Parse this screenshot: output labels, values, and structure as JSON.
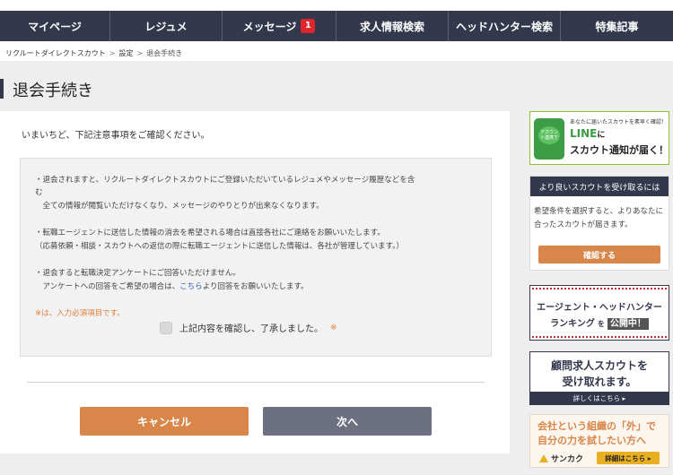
{
  "nav": {
    "items": [
      {
        "label": "マイページ"
      },
      {
        "label": "レジュメ"
      },
      {
        "label": "メッセージ",
        "badge": "1"
      },
      {
        "label": "求人情報検索"
      },
      {
        "label": "ヘッドハンター検索"
      },
      {
        "label": "特集記事"
      }
    ]
  },
  "breadcrumb": {
    "items": [
      "リクルートダイレクトスカウト",
      "設定",
      "退会手続き"
    ],
    "separator": ">"
  },
  "page": {
    "title": "退会手続き",
    "intro": "いまいちど、下記注意事項をご確認ください。"
  },
  "notice": {
    "line1a": "・退会されますと、リクルートダイレクトスカウトにご登録いただいているレジュメやメッセージ履歴などを含",
    "line1b": "む",
    "line1c": "　全ての情報が閲覧いただけなくなり、メッセージのやりとりが出来なくなります。",
    "line2a": "・転職エージェントに送信した情報の消去を希望される場合は直接各社にご連絡をお願いいたします。",
    "line2b": "（応募依頼・相談・スカウトへの返信の際に転職エージェントに送信した情報は、各社が管理しています。）",
    "line3a": "・退会すると転職決定アンケートにご回答いただけません。",
    "line3b_pre": "　アンケートへの回答をご希望の場合は、",
    "line3b_link": "こちら",
    "line3b_post": "より回答をお願いいたします。",
    "required_note": "※は、入力必須項目です。",
    "agree_label": "上記内容を確認し、了承しました。",
    "agree_mark": "※"
  },
  "buttons": {
    "cancel": "キャンセル",
    "next": "次へ"
  },
  "sidebar": {
    "line_ad": {
      "small": "あなたに届いたスカウトを素早く確認！",
      "bubble": "アカウント連携で",
      "big1": "LINE",
      "big1_suffix": "に",
      "big2": "スカウト通知が届く！"
    },
    "scout_box": {
      "heading": "より良いスカウトを受け取るには",
      "text": "希望条件を選択すると、よりあなたに合ったスカウトが届きます。",
      "button": "確認する"
    },
    "rank_ad": {
      "line1": "エージェント・ヘッドハンター",
      "line2": "ランキング",
      "line2_mid": "を",
      "line2_pub": "公開中！"
    },
    "advisor_ad": {
      "line1": "顧問求人スカウトを",
      "line2": "受け取れます。",
      "link": "詳しくはこちら ▸"
    },
    "sankaku_ad": {
      "line1": "会社という組織の「外」で",
      "line2": "自分の力を試したい方へ",
      "logo": "サンカク",
      "button": "詳細はこちら ▸"
    }
  },
  "colors": {
    "nav_bg": "#34384d",
    "badge": "#e0262c",
    "cancel_button": "#d9864a",
    "next_button": "#6d7080",
    "link": "#2f5fb3",
    "required": "#e07b3a"
  }
}
